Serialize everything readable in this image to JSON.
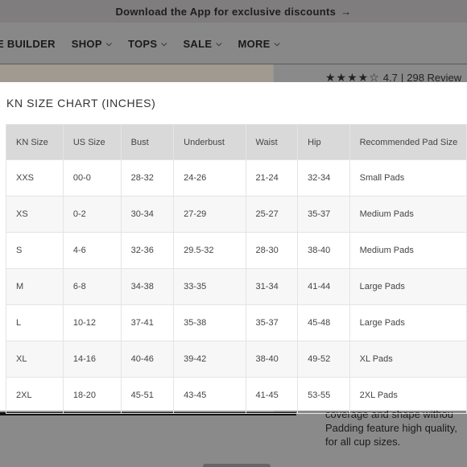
{
  "promo_bar": {
    "text": "Download the App for exclusive discounts",
    "arrow": "→"
  },
  "nav": {
    "items": [
      {
        "label": "E BUILDER",
        "has_chevron": false
      },
      {
        "label": "SHOP",
        "has_chevron": true
      },
      {
        "label": "TOPS",
        "has_chevron": true
      },
      {
        "label": "SALE",
        "has_chevron": true
      },
      {
        "label": "MORE",
        "has_chevron": true
      }
    ],
    "chevron": "⌵"
  },
  "rating": {
    "stars": "★★★★☆",
    "value": "4.7",
    "separator": "|",
    "reviews": "298 Review"
  },
  "description": {
    "line1": "coverage and shape withou",
    "line2": "Padding feature high quality,",
    "line3": "for all cup sizes."
  },
  "size_chart": {
    "title": "KN SIZE CHART (INCHES)",
    "headers": [
      "KN Size",
      "US Size",
      "Bust",
      "Underbust",
      "Waist",
      "Hip",
      "Recommended Pad Size"
    ],
    "rows": [
      [
        "XXS",
        "00-0",
        "28-32",
        "24-26",
        "21-24",
        "32-34",
        "Small Pads"
      ],
      [
        "XS",
        "0-2",
        "30-34",
        "27-29",
        "25-27",
        "35-37",
        "Medium Pads"
      ],
      [
        "S",
        "4-6",
        "32-36",
        "29.5-32",
        "28-30",
        "38-40",
        "Medium Pads"
      ],
      [
        "M",
        "6-8",
        "34-38",
        "33-35",
        "31-34",
        "41-44",
        "Large Pads"
      ],
      [
        "L",
        "10-12",
        "37-41",
        "35-38",
        "35-37",
        "45-48",
        "Large Pads"
      ],
      [
        "XL",
        "14-16",
        "40-46",
        "39-42",
        "38-40",
        "49-52",
        "XL Pads"
      ],
      [
        "2XL",
        "18-20",
        "45-51",
        "43-45",
        "41-45",
        "53-55",
        "2XL Pads"
      ]
    ]
  }
}
